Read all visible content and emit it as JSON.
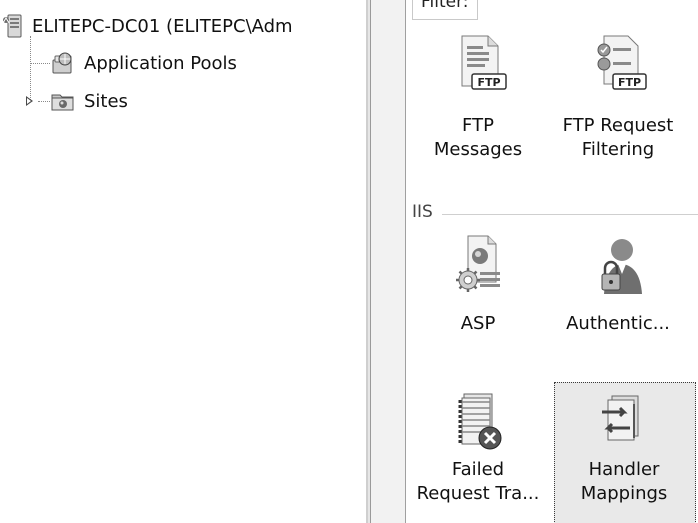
{
  "tree": {
    "server_label": "ELITEPC-DC01 (ELITEPC\\Adm",
    "app_pools_label": "Application Pools",
    "sites_label": "Sites"
  },
  "features": {
    "filter_label": "Filter:",
    "ftp_group": {
      "items": [
        {
          "line1": "FTP",
          "line2": "Messages",
          "icon": "ftp-messages-icon"
        },
        {
          "line1": "FTP Request",
          "line2": "Filtering",
          "icon": "ftp-request-filtering-icon"
        }
      ]
    },
    "iis_group": {
      "header": "IIS",
      "items": [
        {
          "line1": "ASP",
          "line2": "",
          "icon": "asp-icon"
        },
        {
          "line1": "Authentic...",
          "line2": "",
          "icon": "authentication-icon"
        },
        {
          "line1": "Failed",
          "line2": "Request Tra...",
          "icon": "failed-request-tracing-icon"
        },
        {
          "line1": "Handler",
          "line2": "Mappings",
          "icon": "handler-mappings-icon"
        }
      ]
    }
  }
}
